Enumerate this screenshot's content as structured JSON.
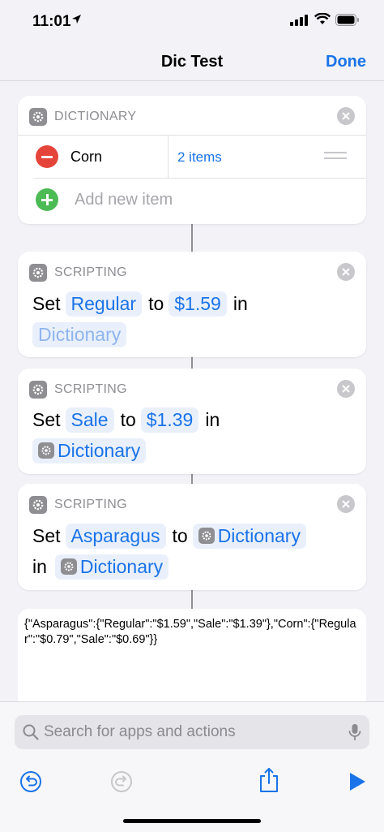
{
  "status_bar": {
    "time": "11:01"
  },
  "nav": {
    "title": "Dic Test",
    "done_label": "Done"
  },
  "dictionary_action": {
    "label": "DICTIONARY",
    "items": [
      {
        "key": "Corn",
        "value": "2 items"
      }
    ],
    "add_label": "Add new item"
  },
  "actions": [
    {
      "label": "SCRIPTING",
      "set": "Set",
      "key": "Regular",
      "to": "to",
      "value": "$1.59",
      "in": "in",
      "target": "Dictionary"
    },
    {
      "label": "SCRIPTING",
      "set": "Set",
      "key": "Sale",
      "to": "to",
      "value": "$1.39",
      "in": "in",
      "target": "Dictionary"
    },
    {
      "label": "SCRIPTING",
      "set": "Set",
      "key": "Asparagus",
      "to": "to",
      "value": "Dictionary",
      "in": "in",
      "target": "Dictionary"
    }
  ],
  "result": {
    "text": "{\"Asparagus\":{\"Regular\":\"$1.59\",\"Sale\":\"$1.39\"},\"Corn\":{\"Regular\":\"$0.79\",\"Sale\":\"$0.69\"}}"
  },
  "search": {
    "placeholder": "Search for apps and actions"
  },
  "colors": {
    "accent": "#1a73e8",
    "delete": "#e5443a",
    "add": "#4cbb55",
    "background": "#f2f2f7"
  },
  "icons": [
    "location-arrow-icon",
    "cellular-signal-icon",
    "wifi-icon",
    "battery-icon",
    "gear-icon",
    "close-icon",
    "minus-icon",
    "plus-icon",
    "drag-handle-icon",
    "search-icon",
    "microphone-icon",
    "undo-icon",
    "redo-icon",
    "share-icon",
    "play-icon"
  ]
}
